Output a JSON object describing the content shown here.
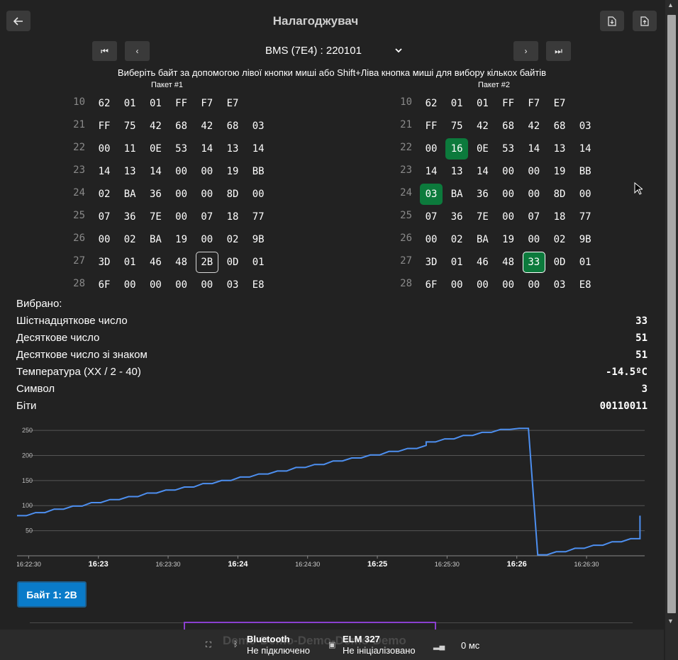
{
  "header": {
    "title": "Налагоджувач",
    "back_icon": "arrow-left-icon",
    "download_icons": [
      "file-download-icon",
      "file-import-icon"
    ]
  },
  "nav": {
    "first_icon": "skip-first-icon",
    "prev_icon": "chevron-left-icon",
    "next_icon": "chevron-right-icon",
    "last_icon": "skip-last-icon",
    "device": "BMS (7E4) : 220101"
  },
  "hint": "Виберіть байт за допомогою лівої кнопки миші або Shift+Ліва кнопка миші для вибору кількох байтів",
  "packets": [
    {
      "label": "Пакет #1",
      "rows": [
        {
          "id": "10",
          "bytes": [
            "62",
            "01",
            "01",
            "FF",
            "F7",
            "E7"
          ]
        },
        {
          "id": "21",
          "bytes": [
            "FF",
            "75",
            "42",
            "68",
            "42",
            "68",
            "03"
          ]
        },
        {
          "id": "22",
          "bytes": [
            "00",
            "11",
            "0E",
            "53",
            "14",
            "13",
            "14"
          ]
        },
        {
          "id": "23",
          "bytes": [
            "14",
            "13",
            "14",
            "00",
            "00",
            "19",
            "BB"
          ]
        },
        {
          "id": "24",
          "bytes": [
            "02",
            "BA",
            "36",
            "00",
            "00",
            "8D",
            "00"
          ]
        },
        {
          "id": "25",
          "bytes": [
            "07",
            "36",
            "7E",
            "00",
            "07",
            "18",
            "77"
          ]
        },
        {
          "id": "26",
          "bytes": [
            "00",
            "02",
            "BA",
            "19",
            "00",
            "02",
            "9B"
          ]
        },
        {
          "id": "27",
          "bytes": [
            "3D",
            "01",
            "46",
            "48",
            "2B",
            "0D",
            "01"
          ]
        },
        {
          "id": "28",
          "bytes": [
            "6F",
            "00",
            "00",
            "00",
            "00",
            "03",
            "E8"
          ]
        }
      ]
    },
    {
      "label": "Пакет #2",
      "rows": [
        {
          "id": "10",
          "bytes": [
            "62",
            "01",
            "01",
            "FF",
            "F7",
            "E7"
          ]
        },
        {
          "id": "21",
          "bytes": [
            "FF",
            "75",
            "42",
            "68",
            "42",
            "68",
            "03"
          ]
        },
        {
          "id": "22",
          "bytes": [
            "00",
            "16",
            "0E",
            "53",
            "14",
            "13",
            "14"
          ]
        },
        {
          "id": "23",
          "bytes": [
            "14",
            "13",
            "14",
            "00",
            "00",
            "19",
            "BB"
          ]
        },
        {
          "id": "24",
          "bytes": [
            "03",
            "BA",
            "36",
            "00",
            "00",
            "8D",
            "00"
          ]
        },
        {
          "id": "25",
          "bytes": [
            "07",
            "36",
            "7E",
            "00",
            "07",
            "18",
            "77"
          ]
        },
        {
          "id": "26",
          "bytes": [
            "00",
            "02",
            "BA",
            "19",
            "00",
            "02",
            "9B"
          ]
        },
        {
          "id": "27",
          "bytes": [
            "3D",
            "01",
            "46",
            "48",
            "33",
            "0D",
            "01"
          ]
        },
        {
          "id": "28",
          "bytes": [
            "6F",
            "00",
            "00",
            "00",
            "00",
            "03",
            "E8"
          ]
        }
      ]
    }
  ],
  "selection": {
    "outlined_packet1": {
      "row": 7,
      "col": 4
    },
    "highlighted_packet2": [
      {
        "row": 2,
        "col": 1
      },
      {
        "row": 4,
        "col": 0
      },
      {
        "row": 7,
        "col": 4
      }
    ],
    "outlined_packet2": {
      "row": 7,
      "col": 4
    },
    "highlight_color": "#0c7a3c"
  },
  "info": {
    "selected_label": "Вибрано:",
    "rows": [
      {
        "label": "Шістнадцяткове число",
        "value": "33"
      },
      {
        "label": "Десяткове число",
        "value": "51"
      },
      {
        "label": "Десяткове число зі знаком",
        "value": "51"
      },
      {
        "label": "Температура (XX / 2 - 40)",
        "value": "-14.5ºC"
      },
      {
        "label": "Символ",
        "value": "3"
      },
      {
        "label": "Біти",
        "value": "00110011"
      }
    ]
  },
  "chart_data": {
    "type": "line",
    "line_color": "#4d8ff0",
    "grid": true,
    "ylim": [
      0,
      260
    ],
    "xlim": [
      "16:22:25",
      "16:26:55"
    ],
    "yticks": [
      50,
      100,
      150,
      200,
      250
    ],
    "ytick_labels": [
      "50",
      "100",
      "150",
      "200",
      "250"
    ],
    "xticks": [
      "16:22:30",
      "16:23:00",
      "16:23:30",
      "16:24:00",
      "16:24:30",
      "16:25:00",
      "16:25:30",
      "16:26:00",
      "16:26:30"
    ],
    "xtick_labels": [
      "16:22:30",
      "16:23",
      "16:23:30",
      "16:24",
      "16:24:30",
      "16:25",
      "16:25:30",
      "16:26",
      "16:26:30"
    ],
    "x": [
      "16:22:25",
      "16:22:29",
      "16:22:33",
      "16:22:37",
      "16:22:41",
      "16:22:45",
      "16:22:49",
      "16:22:53",
      "16:22:57",
      "16:23:01",
      "16:23:05",
      "16:23:09",
      "16:23:13",
      "16:23:17",
      "16:23:21",
      "16:23:25",
      "16:23:29",
      "16:23:33",
      "16:23:37",
      "16:23:41",
      "16:23:45",
      "16:23:49",
      "16:23:53",
      "16:23:57",
      "16:24:01",
      "16:24:05",
      "16:24:09",
      "16:24:13",
      "16:24:17",
      "16:24:21",
      "16:24:25",
      "16:24:29",
      "16:24:33",
      "16:24:37",
      "16:24:41",
      "16:24:45",
      "16:24:49",
      "16:24:53",
      "16:24:57",
      "16:25:01",
      "16:25:05",
      "16:25:09",
      "16:25:13",
      "16:25:17",
      "16:25:21",
      "16:25:21",
      "16:25:25",
      "16:25:29",
      "16:25:33",
      "16:25:37",
      "16:25:41",
      "16:25:45",
      "16:25:49",
      "16:25:53",
      "16:25:57",
      "16:26:01",
      "16:26:05",
      "16:26:09",
      "16:26:13",
      "16:26:17",
      "16:26:21",
      "16:26:25",
      "16:26:29",
      "16:26:33",
      "16:26:37",
      "16:26:41",
      "16:26:45",
      "16:26:49",
      "16:26:53"
    ],
    "y": [
      80,
      80,
      86,
      86,
      93,
      93,
      99,
      99,
      106,
      106,
      112,
      112,
      118,
      118,
      125,
      125,
      131,
      131,
      137,
      137,
      144,
      144,
      150,
      150,
      157,
      157,
      163,
      163,
      169,
      169,
      176,
      176,
      182,
      182,
      189,
      189,
      195,
      195,
      201,
      201,
      208,
      208,
      214,
      214,
      220,
      227,
      227,
      233,
      233,
      240,
      240,
      246,
      246,
      252,
      252,
      254,
      254,
      2,
      2,
      8,
      8,
      15,
      15,
      21,
      21,
      28,
      28,
      34,
      34,
      41,
      41,
      47,
      47,
      54,
      54,
      60,
      60,
      66,
      66,
      73,
      73,
      80,
      80
    ]
  },
  "byte_button": "Байт 1: 2B",
  "status": {
    "demo_text": "Demo-Demo-Demo-Demo-Demo",
    "bluetooth": {
      "title": "Bluetooth",
      "state": "Не підключено"
    },
    "elm": {
      "title": "ELM 327",
      "state": "Не ініціалізовано"
    },
    "latency": "0 мс"
  }
}
